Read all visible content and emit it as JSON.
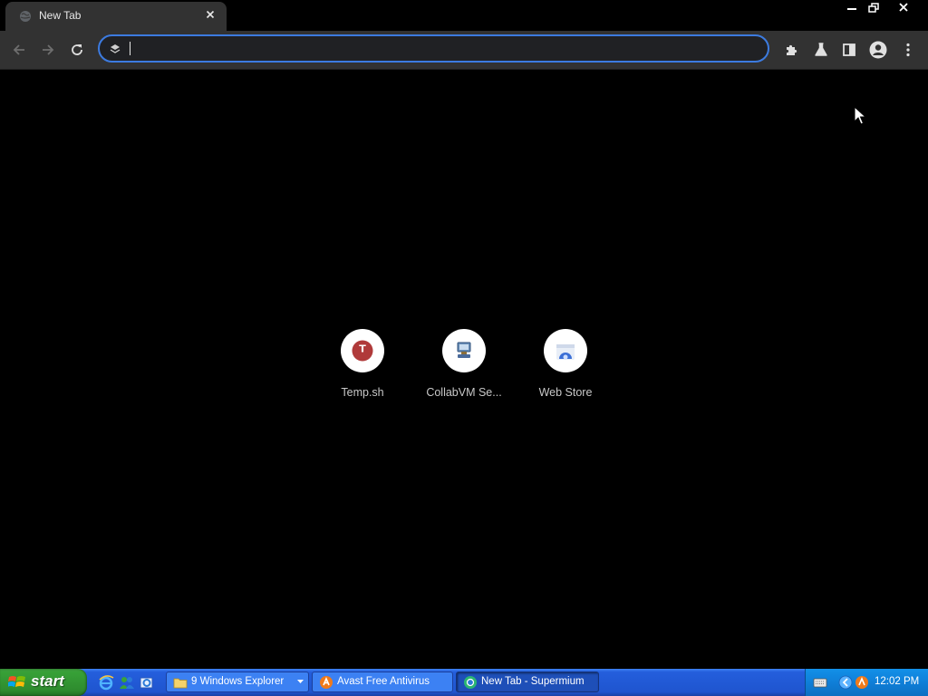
{
  "browser": {
    "tab": {
      "title": "New Tab"
    },
    "omnibox": {
      "value": "",
      "placeholder": ""
    },
    "shortcuts": [
      {
        "label": "Temp.sh",
        "icon": "temp-sh-favicon",
        "letter": "T",
        "color": "#b03a3a"
      },
      {
        "label": "CollabVM Se...",
        "icon": "collabvm-favicon"
      },
      {
        "label": "Web Store",
        "icon": "web-store-favicon"
      }
    ]
  },
  "taskbar": {
    "start_label": "start",
    "tasks": [
      {
        "label": "9 Windows Explorer",
        "icon": "folder-icon"
      },
      {
        "label": "Avast Free Antivirus",
        "icon": "avast-icon"
      },
      {
        "label": "New Tab - Supermium",
        "icon": "supermium-icon"
      }
    ],
    "clock": "12:02 PM"
  },
  "colors": {
    "accent": "#3c7be0",
    "taskbar": "#245edc",
    "start": "#37a037"
  }
}
